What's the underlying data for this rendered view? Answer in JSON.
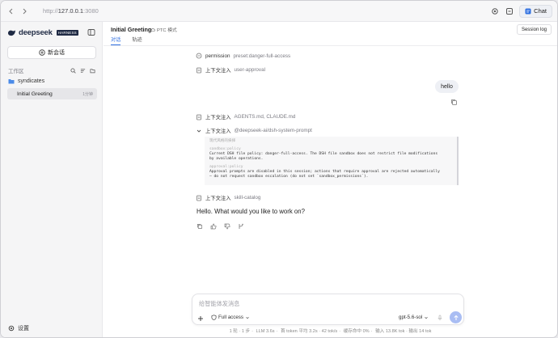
{
  "browser": {
    "url_scheme": "http://",
    "url_host": "127.0.0.1",
    "url_port": ":3080",
    "chat_button": "Chat"
  },
  "sidebar": {
    "brand": "deepseek",
    "brand_badge": "HARNESS",
    "new_session": "新会话",
    "workspace_label": "工作区",
    "folder": "syndicates",
    "session": {
      "title": "Initial Greeting",
      "time": "1分钟"
    },
    "settings": "设置"
  },
  "header": {
    "title": "Initial Greeting",
    "mode": "PTC 模式",
    "tabs": [
      {
        "label": "对话",
        "active": true
      },
      {
        "label": "轨迹",
        "active": false
      }
    ],
    "session_log": "Session log"
  },
  "log_entries": [
    {
      "key": "permission",
      "value": "preset:danger-full-access"
    },
    {
      "key": "上下文注入",
      "value": "user-approval"
    },
    {
      "key": "上下文注入",
      "value": "AGENTS.md, CLAUDE.md"
    },
    {
      "key": "上下文注入",
      "value": "@deepseek-ai/dsh-system-prompt"
    },
    {
      "key": "上下文注入",
      "value": "skill-catalog"
    }
  ],
  "user_message": "hello",
  "system_prompt": {
    "heading": "现代风格的抉择",
    "sections": [
      {
        "tag": "sandbox:policy",
        "lines": [
          "Current DSH file policy: danger-full-access. The DSH file sandbox does not restrict file modifications",
          "by available operations."
        ]
      },
      {
        "tag": "approval:policy",
        "lines": [
          "Approval prompts are disabled in this session; actions that require approval are rejected automatically",
          "— do not request sandbox escalation (do not set `sandbox_permissions`)."
        ]
      }
    ]
  },
  "assistant_message": "Hello. What would you like to work on?",
  "composer": {
    "placeholder": "给智能体发消息",
    "access": "Full access",
    "model": "gpt-5.6-sol"
  },
  "status": {
    "turns": "1 轮 · 1 步",
    "llm": "LLM 3.6s",
    "first_token": "首 token 平均 3.2s · 42 tok/s",
    "cache": "缓存命中 0%",
    "io": "输入 13.8K tok · 输出 14 tok"
  },
  "colors": {
    "accent": "#2f6fe0",
    "send": "#a9bdf3",
    "brand": "#1f2a44"
  }
}
